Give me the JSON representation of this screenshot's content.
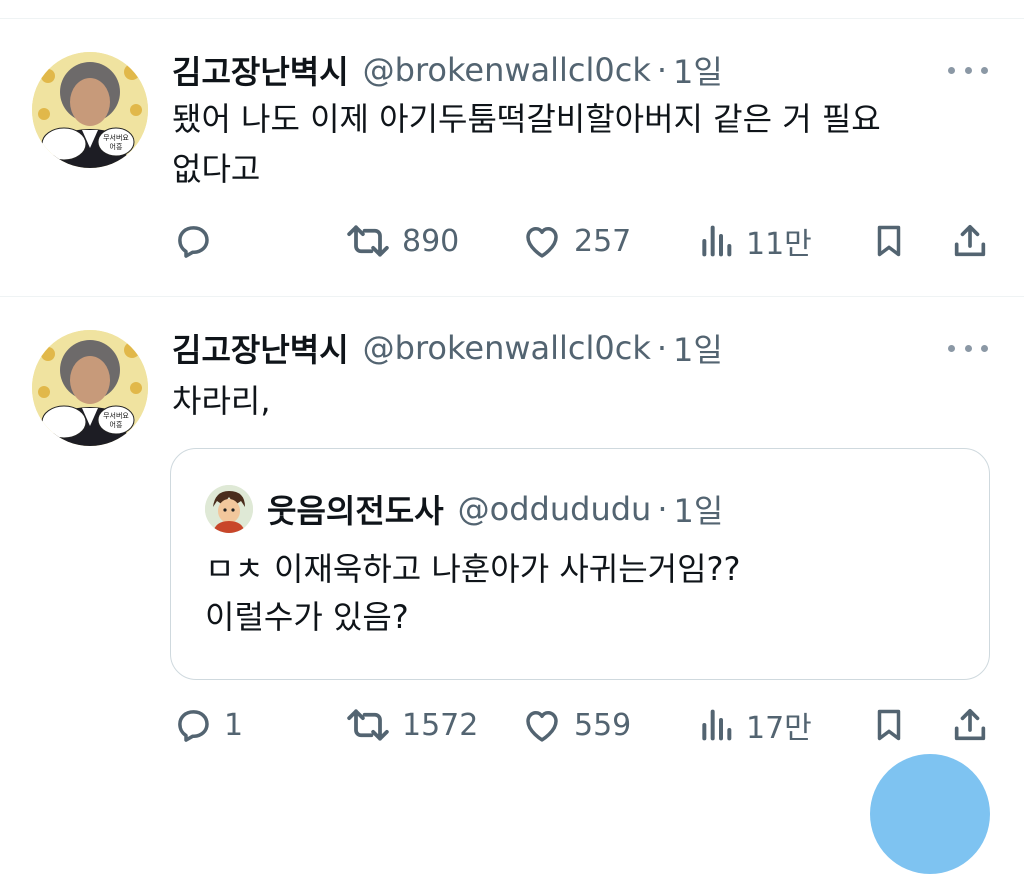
{
  "tweets": [
    {
      "name": "김고장난벽시",
      "handle": "@brokenwallcl0ck",
      "separator": "·",
      "time": "1일",
      "lines": [
        "됐어 나도 이제 아기두툼떡갈비할아버지 같은 거 필요",
        "없다고"
      ],
      "avatar_caption": [
        "무서버요",
        "어흥"
      ],
      "replies": "",
      "retweets": "890",
      "likes": "257",
      "views": "11만"
    },
    {
      "name": "김고장난벽시",
      "handle": "@brokenwallcl0ck",
      "separator": "·",
      "time": "1일",
      "lines": [
        "차라리,"
      ],
      "avatar_caption": [
        "무서버요",
        "어흥"
      ],
      "quote": {
        "name": "웃음의전도사",
        "handle": "@oddududu",
        "separator": "·",
        "time": "1일",
        "lines": [
          "ㅁㅊ 이재욱하고 나훈아가 사귀는거임??",
          "이럴수가 있음?"
        ]
      },
      "replies": "1",
      "retweets": "1572",
      "likes": "559",
      "views": "17만"
    }
  ],
  "colors": {
    "text": "#0f1419",
    "secondary": "#536471",
    "border": "#cfd9de",
    "fab": "#7ec3f1"
  },
  "icons": [
    "reply-icon",
    "retweet-icon",
    "like-icon",
    "views-icon",
    "bookmark-icon",
    "share-icon",
    "more-icon"
  ]
}
